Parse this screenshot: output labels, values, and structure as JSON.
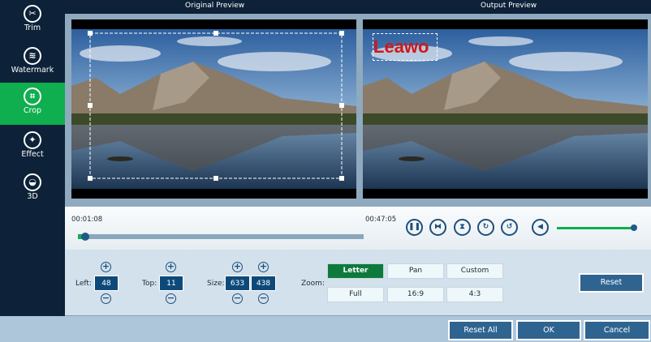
{
  "sidebar": {
    "items": [
      {
        "label": "Trim",
        "icon": "scissors-icon",
        "glyph": "✂"
      },
      {
        "label": "Watermark",
        "icon": "watermark-icon",
        "glyph": "≋"
      },
      {
        "label": "Crop",
        "icon": "crop-icon",
        "glyph": "⌗"
      },
      {
        "label": "Effect",
        "icon": "effect-icon",
        "glyph": "✦"
      },
      {
        "label": "3D",
        "icon": "3d-glasses-icon",
        "glyph": "◒"
      }
    ],
    "active": "Crop"
  },
  "header": {
    "original": "Original Preview",
    "output": "Output Preview"
  },
  "watermark_text": "Leawo",
  "player": {
    "current_time": "00:01:08",
    "total_time": "00:47:05",
    "progress": 0.02,
    "volume": 1.0
  },
  "crop": {
    "left_label": "Left:",
    "left": "48",
    "top_label": "Top:",
    "top": "11",
    "size_label": "Size:",
    "width": "633",
    "height": "438",
    "zoom_label": "Zoom:",
    "zoom_options": [
      "Letter",
      "Pan",
      "Custom",
      "Full",
      "16:9",
      "4:3"
    ],
    "zoom_selected": "Letter",
    "reset": "Reset"
  },
  "footer": {
    "reset_all": "Reset All",
    "ok": "OK",
    "cancel": "Cancel"
  },
  "colors": {
    "sidebar": "#0d2238",
    "accent": "#0fae4f",
    "button": "#2f6491"
  }
}
